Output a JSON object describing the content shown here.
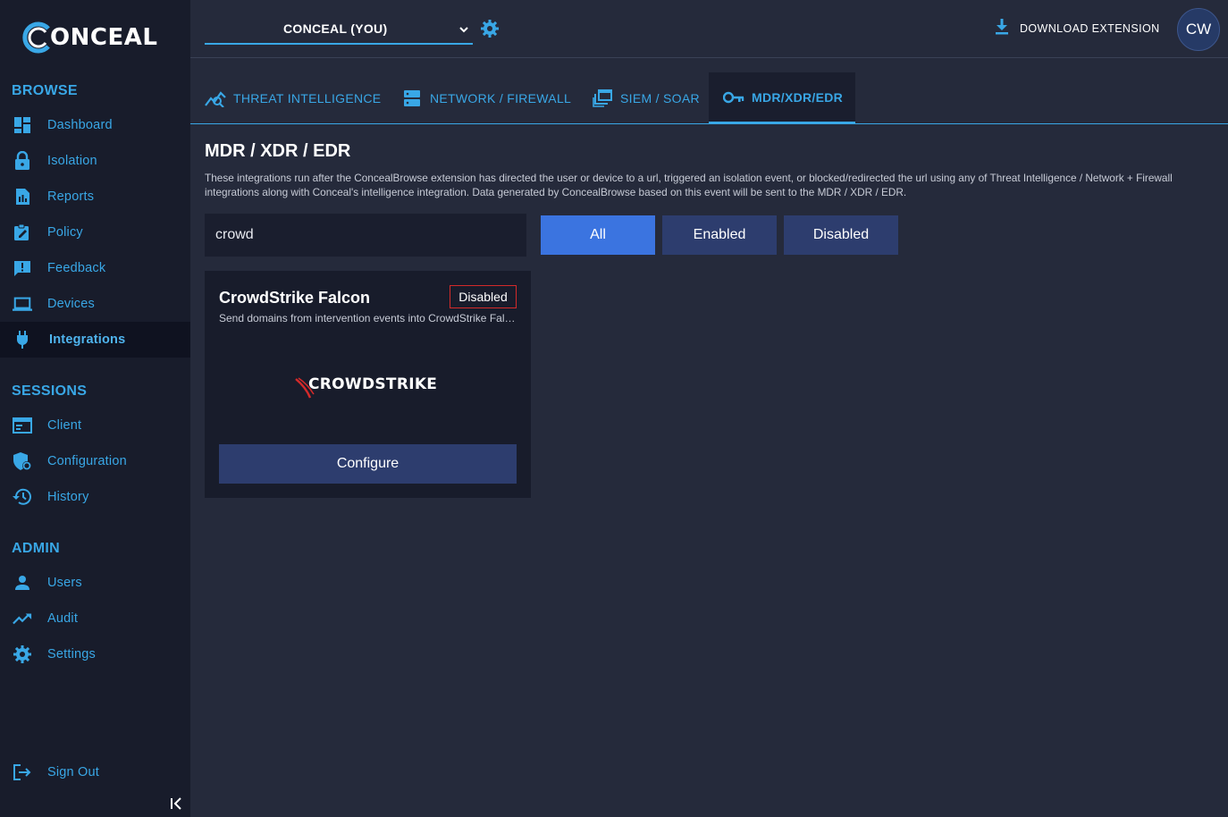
{
  "app": {
    "logo_text": "ONCEAL"
  },
  "sidebar": {
    "sections": [
      {
        "title": "BROWSE",
        "items": [
          {
            "label": "Dashboard",
            "icon": "dashboard-icon"
          },
          {
            "label": "Isolation",
            "icon": "lock-icon"
          },
          {
            "label": "Reports",
            "icon": "report-icon"
          },
          {
            "label": "Policy",
            "icon": "policy-icon"
          },
          {
            "label": "Feedback",
            "icon": "feedback-icon"
          },
          {
            "label": "Devices",
            "icon": "laptop-icon"
          },
          {
            "label": "Integrations",
            "icon": "plug-icon",
            "active": true
          }
        ]
      },
      {
        "title": "SESSIONS",
        "items": [
          {
            "label": "Client",
            "icon": "browser-window-icon"
          },
          {
            "label": "Configuration",
            "icon": "shield-gear-icon"
          },
          {
            "label": "History",
            "icon": "history-icon"
          }
        ]
      },
      {
        "title": "ADMIN",
        "items": [
          {
            "label": "Users",
            "icon": "user-icon"
          },
          {
            "label": "Audit",
            "icon": "trend-icon"
          },
          {
            "label": "Settings",
            "icon": "gear-icon"
          }
        ]
      }
    ],
    "sign_out": "Sign Out"
  },
  "header": {
    "tenant": "CONCEAL (YOU)",
    "download": "DOWNLOAD EXTENSION",
    "avatar": "CW"
  },
  "tabs": [
    {
      "label": "THREAT INTELLIGENCE",
      "icon": "threat-chart-icon"
    },
    {
      "label": "NETWORK / FIREWALL",
      "icon": "server-icon"
    },
    {
      "label": "SIEM / SOAR",
      "icon": "windows-stack-icon"
    },
    {
      "label": "MDR/XDR/EDR",
      "icon": "key-icon",
      "active": true
    }
  ],
  "main": {
    "title": "MDR / XDR / EDR",
    "description": "These integrations run after the ConcealBrowse extension has directed the user or device to a url, triggered an isolation event, or blocked/redirected the url using any of Threat Intelligence / Network + Firewall integrations along with Conceal's intelligence integration. Data generated by ConcealBrowse based on this event will be sent to the MDR / XDR / EDR.",
    "search_value": "crowd",
    "filters": {
      "all": "All",
      "enabled": "Enabled",
      "disabled": "Disabled"
    }
  },
  "card": {
    "title": "CrowdStrike Falcon",
    "badge": "Disabled",
    "description": "Send domains from intervention events into CrowdStrike Falcon",
    "brand": "CROWDSTRIKE",
    "configure": "Configure"
  },
  "colors": {
    "accent": "#39a7e6",
    "primary_button": "#3b74e0",
    "secondary_button": "#2d3d6e",
    "badge_border": "#d42a2a"
  }
}
